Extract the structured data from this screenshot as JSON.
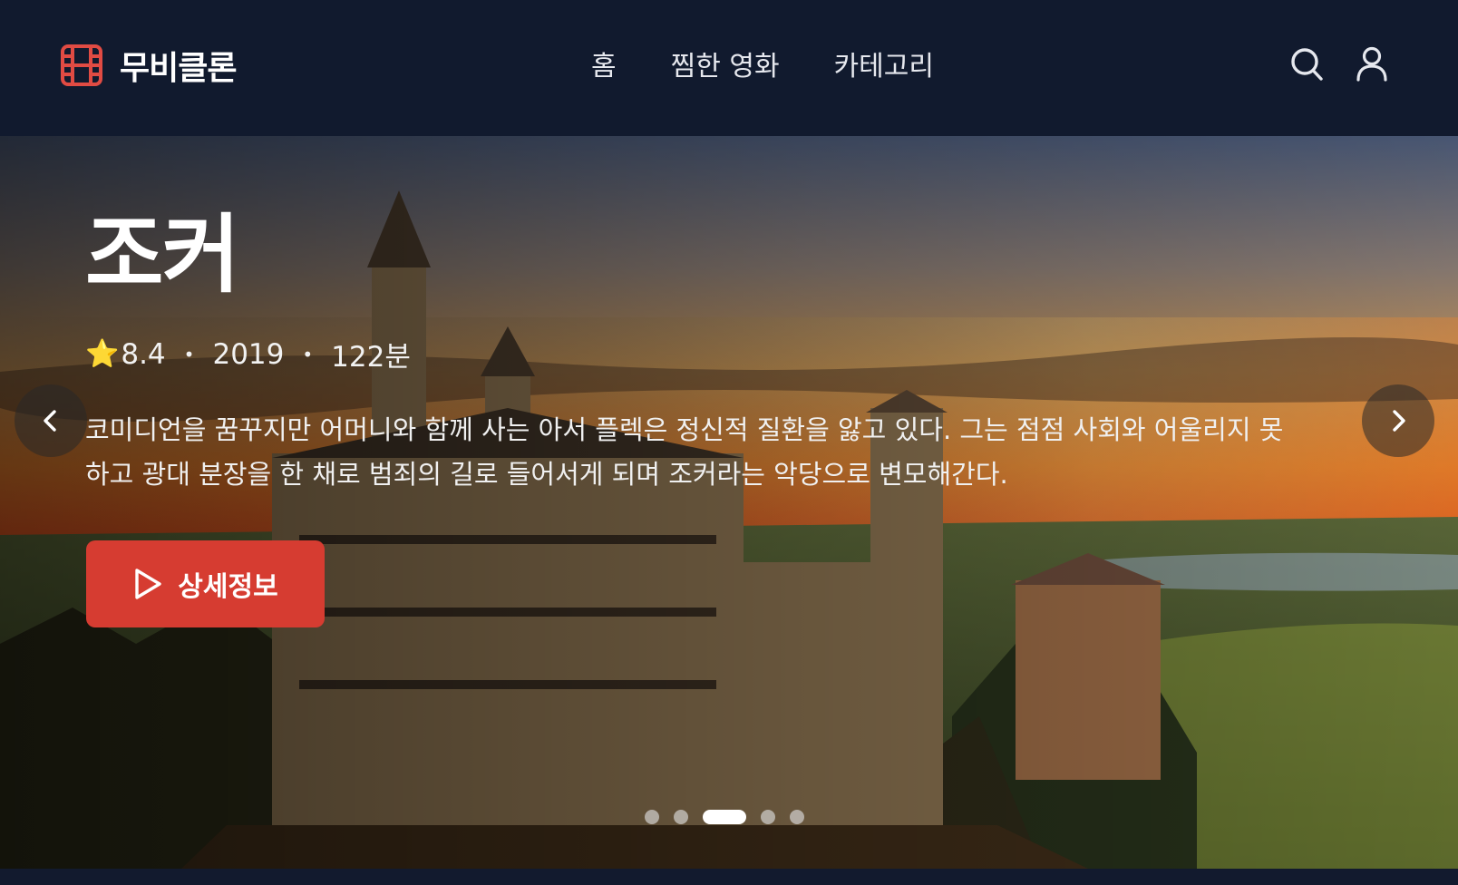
{
  "brand": {
    "name": "무비클론",
    "icon": "film-icon",
    "accent": "#e14b43"
  },
  "nav": {
    "items": [
      "홈",
      "찜한 영화",
      "카테고리"
    ]
  },
  "header_icons": [
    "search-icon",
    "user-icon"
  ],
  "hero": {
    "title": "조커",
    "rating_icon": "⭐",
    "rating": "8.4",
    "separator": "•",
    "year": "2019",
    "runtime": "122분",
    "description": "코미디언을 꿈꾸지만 어머니와 함께 사는 아서 플렉은 정신적 질환을 앓고 있다. 그는 점점 사회와 어울리지 못하고 광대 분장을 한 채로 범죄의 길로 들어서게 되며 조커라는 악당으로 변모해간다.",
    "button_label": "상세정보",
    "button_color": "#d63c31",
    "slides_total": 5,
    "active_slide": 3
  }
}
